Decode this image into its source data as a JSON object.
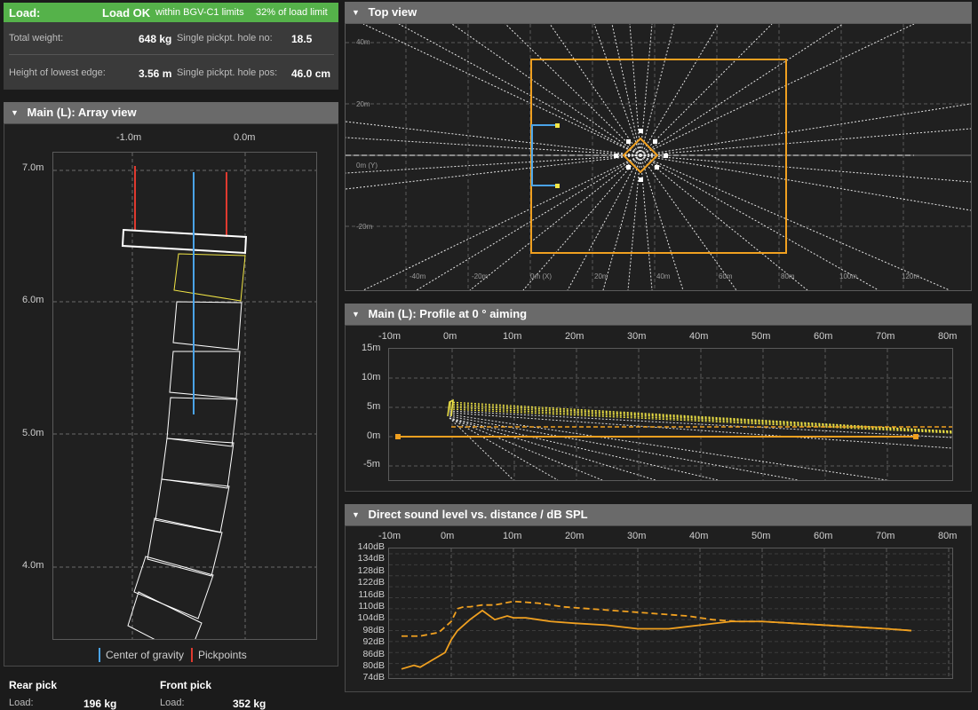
{
  "load": {
    "title": "Load:",
    "status": "Load OK",
    "limits": "within BGV-C1 limits",
    "percent": "32% of load limit",
    "rows": [
      {
        "label1": "Total weight:",
        "value1": "648 kg",
        "label2": "Single pickpt. hole no:",
        "value2": "18.5"
      },
      {
        "label1": "Height of lowest edge:",
        "value1": "3.56 m",
        "label2": "Single pickpt. hole pos:",
        "value2": "46.0 cm"
      }
    ]
  },
  "array_view": {
    "title": "Main (L): Array view",
    "x_ticks": [
      "-1.0m",
      "0.0m"
    ],
    "y_ticks": [
      "7.0m",
      "6.0m",
      "5.0m",
      "4.0m"
    ],
    "legend": [
      {
        "label": "Center of gravity",
        "color": "#4aa3e8"
      },
      {
        "label": "Pickpoints",
        "color": "#e03a2f"
      }
    ]
  },
  "picks": {
    "rear_title": "Rear pick",
    "front_title": "Front pick",
    "rear_load_label": "Load:",
    "rear_load_value": "196 kg",
    "front_load_label": "Load:",
    "front_load_value": "352 kg"
  },
  "top_view": {
    "title": "Top view",
    "y_ticks": [
      "40m",
      "20m",
      "0m (Y)",
      "-20m"
    ],
    "x_ticks": [
      "-40m",
      "-20m",
      "0m (X)",
      "20m",
      "40m",
      "60m",
      "80m",
      "100m",
      "120m"
    ]
  },
  "profile": {
    "title": "Main (L): Profile at 0 ° aiming",
    "x_ticks": [
      "-10m",
      "0m",
      "10m",
      "20m",
      "30m",
      "40m",
      "50m",
      "60m",
      "70m",
      "80m"
    ],
    "y_ticks": [
      "15m",
      "10m",
      "5m",
      "0m",
      "-5m"
    ]
  },
  "spl": {
    "title": "Direct sound level vs. distance / dB SPL",
    "x_ticks": [
      "-10m",
      "0m",
      "10m",
      "20m",
      "30m",
      "40m",
      "50m",
      "60m",
      "70m",
      "80m"
    ],
    "y_ticks": [
      "140dB",
      "134dB",
      "128dB",
      "122dB",
      "116dB",
      "110dB",
      "104dB",
      "98dB",
      "92dB",
      "86dB",
      "80dB",
      "74dB"
    ]
  },
  "colors": {
    "header_green": "#55b24a",
    "accent_orange": "#f0a020",
    "cog_blue": "#4aa3e8",
    "pick_red": "#e03a2f",
    "highlight_yellow": "#f2e646"
  },
  "chart_data": [
    {
      "type": "line",
      "title": "Direct sound level vs. distance / dB SPL",
      "xlabel": "",
      "ylabel": "",
      "xlim": [
        -10,
        80
      ],
      "ylim": [
        74,
        140
      ],
      "series": [
        {
          "style": "dashed",
          "x": [
            -8,
            -5,
            -2,
            0,
            1,
            2,
            3,
            5,
            7,
            10,
            14,
            18,
            22,
            26,
            30,
            34,
            38,
            42,
            46,
            50,
            55,
            60,
            65,
            70,
            74
          ],
          "y": [
            95,
            95,
            97,
            103,
            110,
            111,
            111,
            112,
            112,
            114,
            113,
            111,
            110,
            109,
            108,
            107,
            106,
            104,
            103,
            103,
            102,
            101,
            100,
            99,
            98
          ]
        },
        {
          "style": "solid",
          "x": [
            -8,
            -6,
            -5,
            -3,
            -1,
            0,
            1,
            3,
            5,
            7,
            9,
            10,
            12,
            14,
            16,
            20,
            25,
            30,
            35,
            40,
            45,
            50,
            55,
            60,
            65,
            70,
            74
          ],
          "y": [
            77,
            79,
            78,
            82,
            86,
            93,
            98,
            104,
            109,
            104,
            106,
            105,
            105,
            104,
            103,
            102,
            101,
            99,
            99,
            101,
            103,
            103,
            102,
            101,
            100,
            99,
            98
          ]
        }
      ]
    }
  ]
}
